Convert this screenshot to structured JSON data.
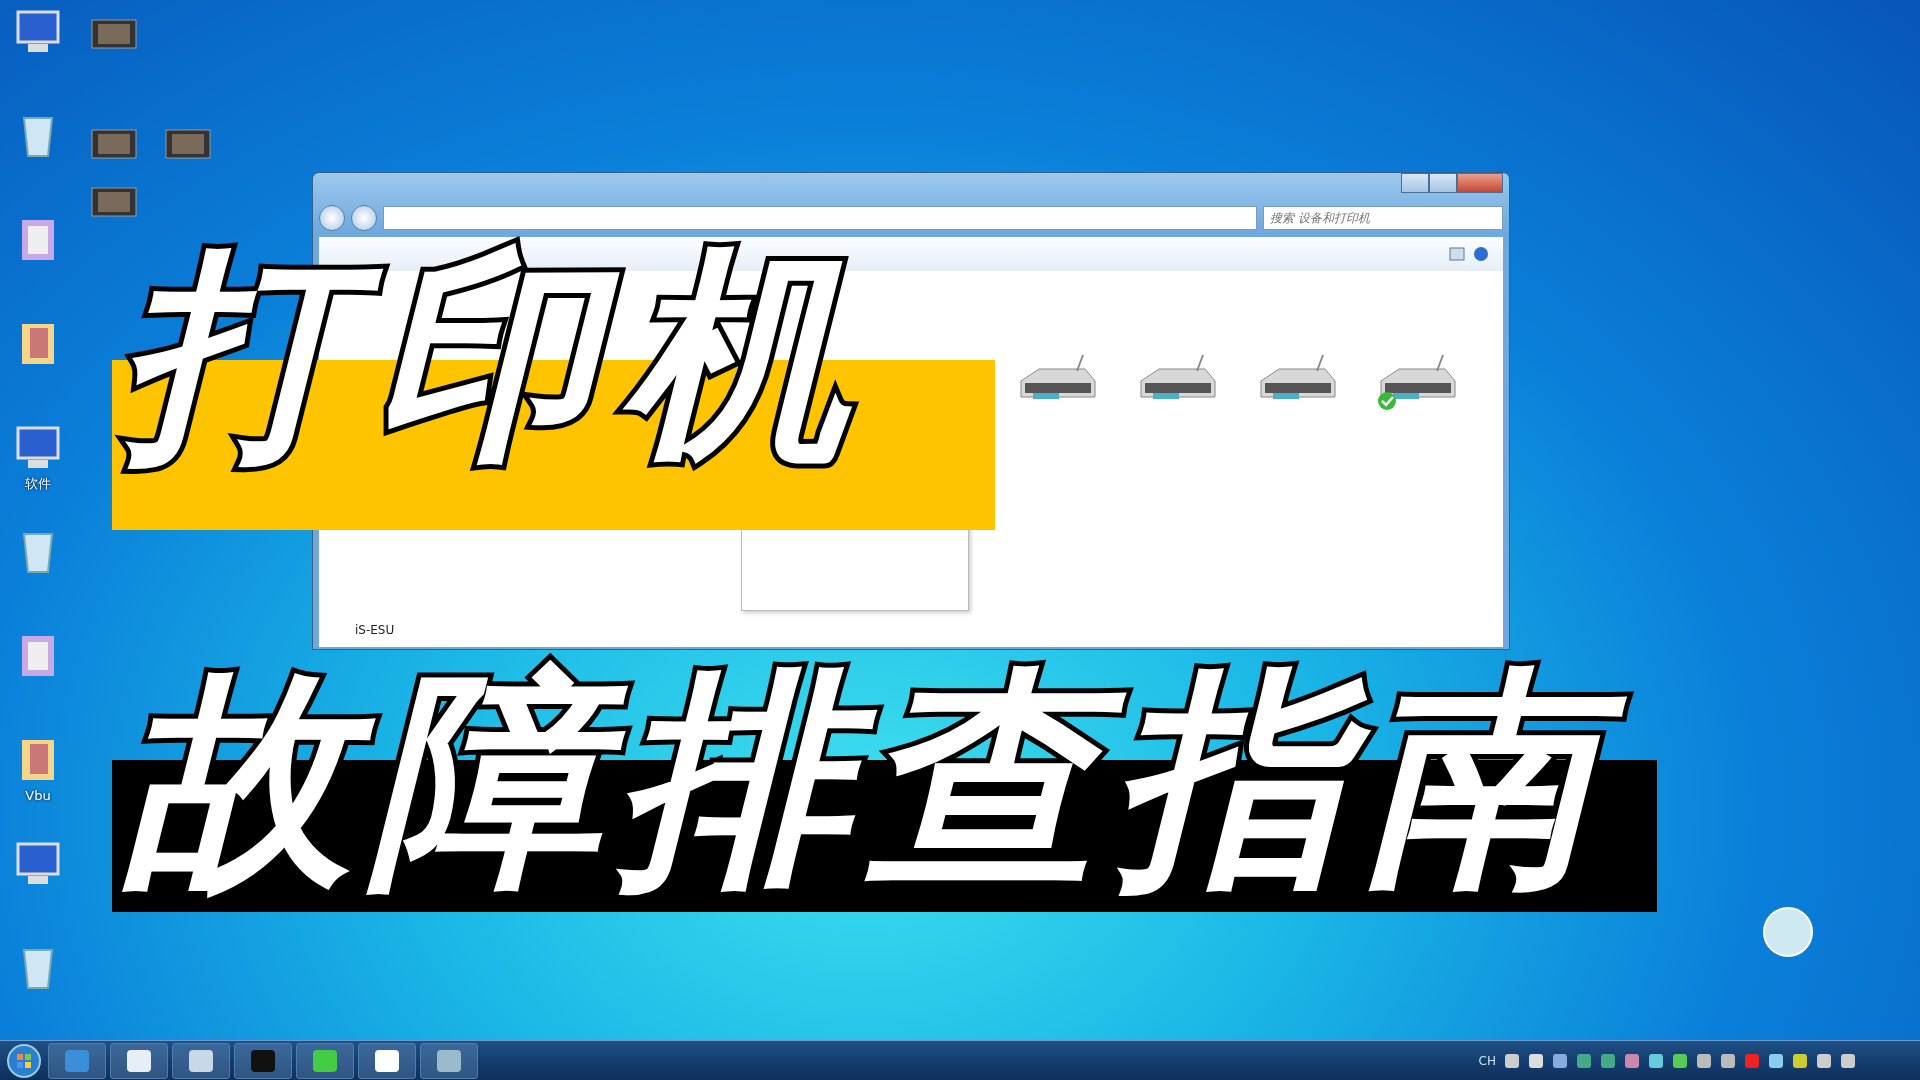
{
  "desktop": {
    "icons": [
      {
        "kind": "shortcut"
      },
      {
        "kind": "shortcut"
      },
      {
        "kind": "shortcut"
      },
      {
        "kind": "shortcut"
      },
      {
        "kind": "shortcut",
        "label": "软件"
      },
      {
        "kind": "shortcut"
      },
      {
        "kind": "shortcut"
      },
      {
        "kind": "shortcut",
        "label": "Vbu"
      },
      {
        "kind": "shortcut"
      },
      {
        "kind": "shortcut"
      },
      {
        "kind": "video"
      },
      {
        "kind": "video"
      },
      {
        "kind": "video"
      },
      {
        "kind": "video"
      }
    ]
  },
  "window": {
    "search": {
      "placeholder": "搜索 设备和打印机"
    },
    "printers": [
      {
        "default": false
      },
      {
        "default": false
      },
      {
        "default": false
      },
      {
        "default": true
      }
    ],
    "partial_label": "iS-ESU"
  },
  "headline": [
    {
      "text": "打印机",
      "kind": "highlight"
    },
    {
      "text": "故障排查指南",
      "kind": "dark"
    }
  ],
  "taskbar": {
    "tray_language": "CH"
  }
}
